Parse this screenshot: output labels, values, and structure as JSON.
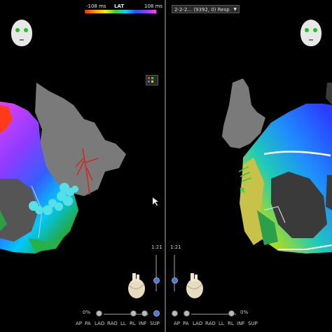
{
  "left_view": {
    "lat_legend": {
      "title": "LAT",
      "min_label": "-108 ms",
      "max_label": "108 ms",
      "gradient": [
        "#ff2a00",
        "#ff9a00",
        "#ffee00",
        "#3bd23b",
        "#00d8ff",
        "#2255ff",
        "#8a3cff",
        "#ff40ff"
      ]
    },
    "zoom_label": "1:21",
    "opacity_label": "0%",
    "view_buttons": [
      "AP",
      "PA",
      "LAO",
      "RAO",
      "LL",
      "RL",
      "INF",
      "SUP"
    ]
  },
  "right_view": {
    "map_select": "2-2-2... (9392, 0) Resp",
    "marker_label": "R",
    "zoom_label": "1:21",
    "opacity_label": "0%",
    "view_buttons": [
      "AP",
      "PA",
      "LAO",
      "RAO",
      "LL",
      "RL",
      "INF",
      "SUP"
    ]
  },
  "colors": {
    "background": "#000000",
    "divider": "#5a5a5a",
    "eye_green": "#19c919",
    "ablation_tag": "#55e0e8"
  }
}
